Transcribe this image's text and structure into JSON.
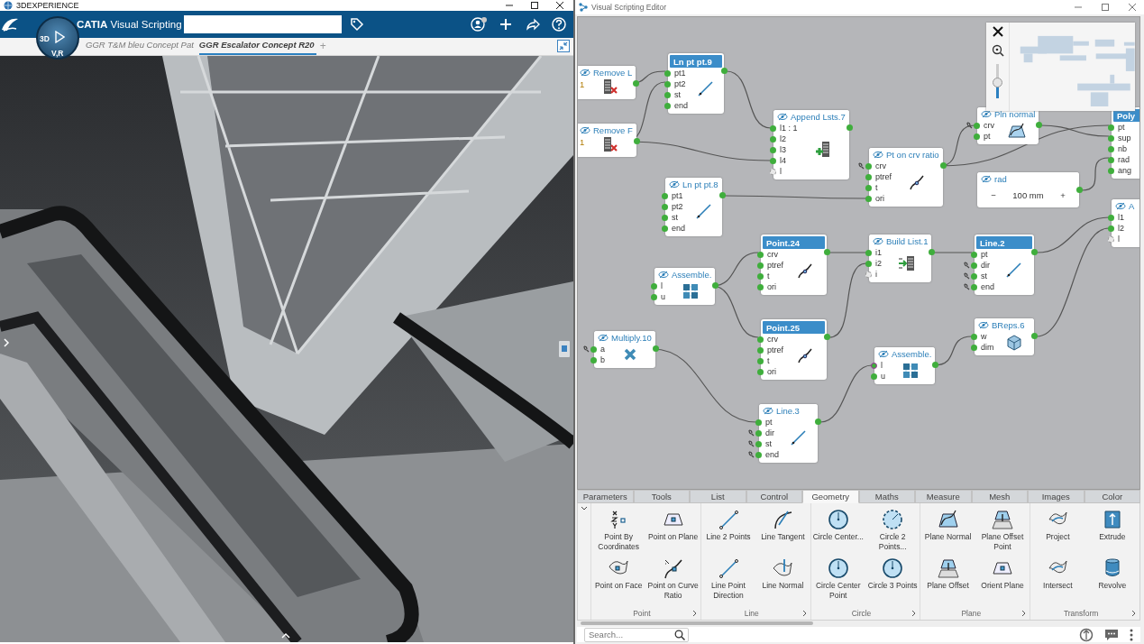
{
  "left_window": {
    "title": "3DEXPERIENCE",
    "app": {
      "brand": "CATIA",
      "name": "Visual Scripting"
    },
    "compass": {
      "labels": [
        "3D",
        "V,R"
      ]
    },
    "tabs": [
      {
        "label": "GGR T&M bleu Concept Pat",
        "selected": false
      },
      {
        "label": "GGR Escalator Concept R20",
        "selected": true
      }
    ],
    "add_tab": "+"
  },
  "editor": {
    "title": "Visual Scripting Editor",
    "nodes": [
      {
        "title": "Remove L",
        "selected": false,
        "kind": "remove-list",
        "ports": [
          {
            "label": "1",
            "kind": "index"
          }
        ]
      },
      {
        "title": "Ln pt pt.9",
        "selected": true,
        "kind": "line",
        "ports": [
          {
            "label": "pt1",
            "kind": "plain"
          },
          {
            "label": "pt2",
            "kind": "plain"
          },
          {
            "label": "st",
            "kind": "plain"
          },
          {
            "label": "end",
            "kind": "plain"
          }
        ]
      },
      {
        "title": "Remove F",
        "selected": false,
        "kind": "remove-list",
        "ports": [
          {
            "label": "1",
            "kind": "index"
          }
        ]
      },
      {
        "title": "Append Lsts.7",
        "selected": false,
        "kind": "append",
        "ports": [
          {
            "label": "l1 : 1",
            "kind": "plain"
          },
          {
            "label": "l2",
            "kind": "plain"
          },
          {
            "label": "l3",
            "kind": "plain"
          },
          {
            "label": "l4",
            "kind": "plain"
          },
          {
            "label": "l",
            "kind": "spare"
          }
        ]
      },
      {
        "title": "Pln normal",
        "selected": false,
        "kind": "plane",
        "ports": [
          {
            "label": "crv",
            "kind": "set"
          },
          {
            "label": "pt",
            "kind": "plain"
          }
        ]
      },
      {
        "title": "Pt on crv ratio",
        "selected": false,
        "kind": "curve-ratio",
        "ports": [
          {
            "label": "crv",
            "kind": "set"
          },
          {
            "label": "ptref",
            "kind": "plain"
          },
          {
            "label": "t",
            "kind": "plain"
          },
          {
            "label": "ori",
            "kind": "plain"
          }
        ]
      },
      {
        "title": "rad",
        "selected": false,
        "kind": "value",
        "value": "100 mm",
        "minus": "−",
        "plus": "+"
      },
      {
        "title": "Ln pt pt.8",
        "selected": false,
        "kind": "line",
        "ports": [
          {
            "label": "pt1",
            "kind": "plain"
          },
          {
            "label": "pt2",
            "kind": "plain"
          },
          {
            "label": "st",
            "kind": "plain"
          },
          {
            "label": "end",
            "kind": "plain"
          }
        ]
      },
      {
        "title": "Poly",
        "selected": true,
        "kind": "none",
        "ports": [
          {
            "label": "pt",
            "kind": "plain"
          },
          {
            "label": "sup",
            "kind": "plain"
          },
          {
            "label": "nb",
            "kind": "plain"
          },
          {
            "label": "rad",
            "kind": "plain"
          },
          {
            "label": "ang",
            "kind": "plain"
          }
        ]
      },
      {
        "title": "A",
        "selected": false,
        "kind": "none",
        "ports": [
          {
            "label": "l1",
            "kind": "plain"
          },
          {
            "label": "l2",
            "kind": "plain"
          },
          {
            "label": "l",
            "kind": "spare"
          }
        ]
      },
      {
        "title": "Point.24",
        "selected": true,
        "kind": "curve-ratio",
        "ports": [
          {
            "label": "crv",
            "kind": "plain"
          },
          {
            "label": "ptref",
            "kind": "plain"
          },
          {
            "label": "t",
            "kind": "plain"
          },
          {
            "label": "ori",
            "kind": "plain"
          }
        ]
      },
      {
        "title": "Build List.1",
        "selected": false,
        "kind": "build",
        "ports": [
          {
            "label": "i1",
            "kind": "plain"
          },
          {
            "label": "i2",
            "kind": "plain"
          },
          {
            "label": "i",
            "kind": "spare"
          }
        ]
      },
      {
        "title": "Line.2",
        "selected": true,
        "kind": "line",
        "ports": [
          {
            "label": "pt",
            "kind": "plain"
          },
          {
            "label": "dir",
            "kind": "set"
          },
          {
            "label": "st",
            "kind": "set"
          },
          {
            "label": "end",
            "kind": "set"
          }
        ]
      },
      {
        "title": "Assemble.",
        "selected": false,
        "kind": "assemble",
        "ports": [
          {
            "label": "l",
            "kind": "plain"
          },
          {
            "label": "u",
            "kind": "plain"
          }
        ]
      },
      {
        "title": "Multiply.10",
        "selected": false,
        "kind": "multiply",
        "ports": [
          {
            "label": "a",
            "kind": "set"
          },
          {
            "label": "b",
            "kind": "plain"
          }
        ]
      },
      {
        "title": "Point.25",
        "selected": true,
        "kind": "curve-ratio",
        "ports": [
          {
            "label": "crv",
            "kind": "plain"
          },
          {
            "label": "ptref",
            "kind": "plain"
          },
          {
            "label": "t",
            "kind": "plain"
          },
          {
            "label": "ori",
            "kind": "plain"
          }
        ]
      },
      {
        "title": "BReps.6",
        "selected": false,
        "kind": "breps",
        "ports": [
          {
            "label": "w",
            "kind": "plain"
          },
          {
            "label": "dim",
            "kind": "plain"
          }
        ]
      },
      {
        "title": "Assemble.",
        "selected": false,
        "kind": "assemble",
        "ports": [
          {
            "label": "l",
            "kind": "active"
          },
          {
            "label": "u",
            "kind": "plain"
          }
        ]
      },
      {
        "title": "Line.3",
        "selected": false,
        "kind": "line",
        "ports": [
          {
            "label": "pt",
            "kind": "plain"
          },
          {
            "label": "dir",
            "kind": "set"
          },
          {
            "label": "st",
            "kind": "set"
          },
          {
            "label": "end",
            "kind": "set"
          }
        ]
      }
    ],
    "minimap": {
      "slider": {
        "level": 0.45
      }
    }
  },
  "palette": {
    "tabs": [
      {
        "label": "Parameters",
        "selected": false
      },
      {
        "label": "Tools",
        "selected": false
      },
      {
        "label": "List",
        "selected": false
      },
      {
        "label": "Control",
        "selected": false
      },
      {
        "label": "Geometry",
        "selected": true
      },
      {
        "label": "Maths",
        "selected": false
      },
      {
        "label": "Measure",
        "selected": false
      },
      {
        "label": "Mesh",
        "selected": false
      },
      {
        "label": "Images",
        "selected": false
      },
      {
        "label": "Color",
        "selected": false
      }
    ],
    "groups": [
      {
        "label": "Point",
        "items": [
          {
            "label": "Point By Coordinates",
            "kind": "xyz"
          },
          {
            "label": "Point on Plane",
            "kind": "plane-point"
          },
          {
            "label": "Point on Face",
            "kind": "face-point"
          },
          {
            "label": "Point on Curve Ratio",
            "kind": "curve-ratio"
          }
        ]
      },
      {
        "label": "Line",
        "items": [
          {
            "label": "Line 2 Points",
            "kind": "line"
          },
          {
            "label": "Line Tangent",
            "kind": "tangent"
          },
          {
            "label": "Line Point Direction",
            "kind": "line"
          },
          {
            "label": "Line Normal",
            "kind": "line-normal"
          }
        ]
      },
      {
        "label": "Circle",
        "items": [
          {
            "label": "Circle Center...",
            "kind": "circle"
          },
          {
            "label": "Circle 2 Points...",
            "kind": "circle-dashed"
          },
          {
            "label": "Circle Center Point",
            "kind": "circle"
          },
          {
            "label": "Circle 3 Points",
            "kind": "circle"
          }
        ]
      },
      {
        "label": "Plane",
        "items": [
          {
            "label": "Plane Normal",
            "kind": "plane-normal"
          },
          {
            "label": "Plane Offset Point",
            "kind": "plane-offset"
          },
          {
            "label": "Plane Offset",
            "kind": "plane-offset"
          },
          {
            "label": "Orient Plane",
            "kind": "plane-point"
          }
        ]
      },
      {
        "label": "Transform",
        "items": [
          {
            "label": "Project",
            "kind": "surface"
          },
          {
            "label": "Extrude",
            "kind": "extrude"
          },
          {
            "label": "Intersect",
            "kind": "surface"
          },
          {
            "label": "Revolve",
            "kind": "revolve"
          }
        ]
      }
    ],
    "search": {
      "placeholder": "Search..."
    }
  }
}
